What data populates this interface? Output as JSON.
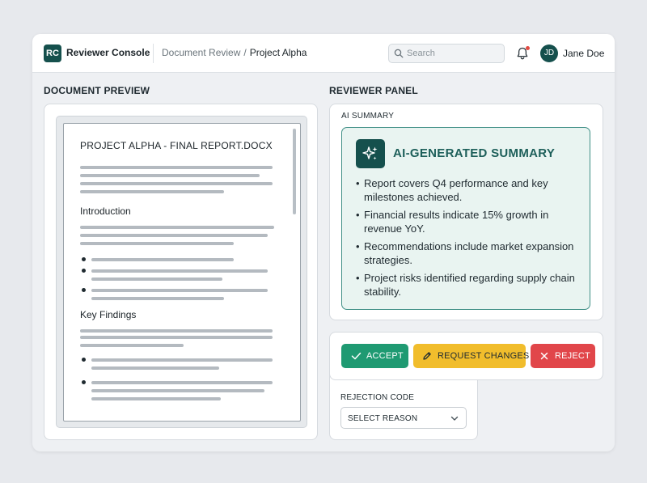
{
  "app": {
    "logo_text": "RC",
    "title": "Reviewer Console"
  },
  "breadcrumb": {
    "items": [
      "Document Review",
      "Project Alpha"
    ],
    "separator": "/"
  },
  "search": {
    "placeholder": "Search",
    "value": ""
  },
  "notifications": {
    "has_unread": true,
    "icon": "bell-icon"
  },
  "user": {
    "initials": "JD",
    "name": "Jane Doe"
  },
  "document_preview": {
    "section_title": "DOCUMENT PREVIEW",
    "doc_title": "PROJECT ALPHA - FINAL REPORT.DOCX",
    "headings": [
      "Introduction",
      "Key Findings"
    ]
  },
  "reviewer_panel": {
    "section_title": "REVIEWER PANEL",
    "summary_label": "AI SUMMARY",
    "summary_heading": "AI-GENERATED SUMMARY",
    "summary_icon": "sparkle-icon",
    "summary_points": [
      "Report covers Q4 performance and key milestones achieved.",
      "Financial results indicate 15% growth in revenue YoY.",
      "Recommendations include market expansion strategies.",
      "Project risks identified regarding supply chain stability."
    ]
  },
  "actions": {
    "accept_label": "ACCEPT",
    "request_changes_label": "REQUEST CHANGES",
    "reject_label": "REJECT"
  },
  "rejection": {
    "label": "REJECTION CODE",
    "selected": "SELECT REASON"
  },
  "colors": {
    "brand": "#15504d",
    "accept": "#1f9a72",
    "request_changes": "#f1bd2c",
    "reject": "#e1464a",
    "summary_bg": "#e9f4f1",
    "summary_border": "#3f8f86"
  }
}
